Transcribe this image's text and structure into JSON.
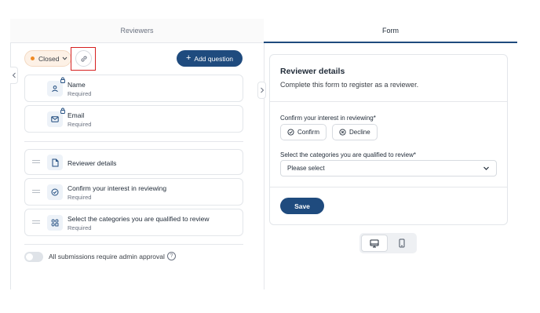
{
  "tabs": [
    {
      "label": "Reviewers",
      "active": false
    },
    {
      "label": "Form",
      "active": true
    }
  ],
  "toolbar": {
    "status_label": "Closed",
    "status_color": "#f08a24",
    "add_question_label": "Add question"
  },
  "fixed_fields": [
    {
      "title": "Name",
      "subtitle": "Required",
      "icon": "user-icon",
      "locked": true
    },
    {
      "title": "Email",
      "subtitle": "Required",
      "icon": "mail-icon",
      "locked": true
    }
  ],
  "questions": [
    {
      "title": "Reviewer details",
      "subtitle": "",
      "icon": "document-icon"
    },
    {
      "title": "Confirm your interest in reviewing",
      "subtitle": "Required",
      "icon": "check-circle-icon"
    },
    {
      "title": "Select the categories you are qualified to review",
      "subtitle": "Required",
      "icon": "categories-icon"
    }
  ],
  "settings": {
    "admin_approval_label": "All submissions require admin approval",
    "admin_approval_on": false
  },
  "form_preview": {
    "title": "Reviewer details",
    "subtitle": "Complete this form to register as a reviewer.",
    "q1_label": "Confirm your interest in reviewing*",
    "q1_options": [
      "Confirm",
      "Decline"
    ],
    "q2_label": "Select the categories you are qualified to review*",
    "q2_placeholder": "Please select",
    "save_label": "Save"
  },
  "device_view": {
    "selected": "desktop",
    "options": [
      "desktop",
      "mobile"
    ]
  },
  "colors": {
    "primary": "#1f4b7e",
    "status_bg": "#fdf1e6",
    "highlight": "#d62020"
  }
}
